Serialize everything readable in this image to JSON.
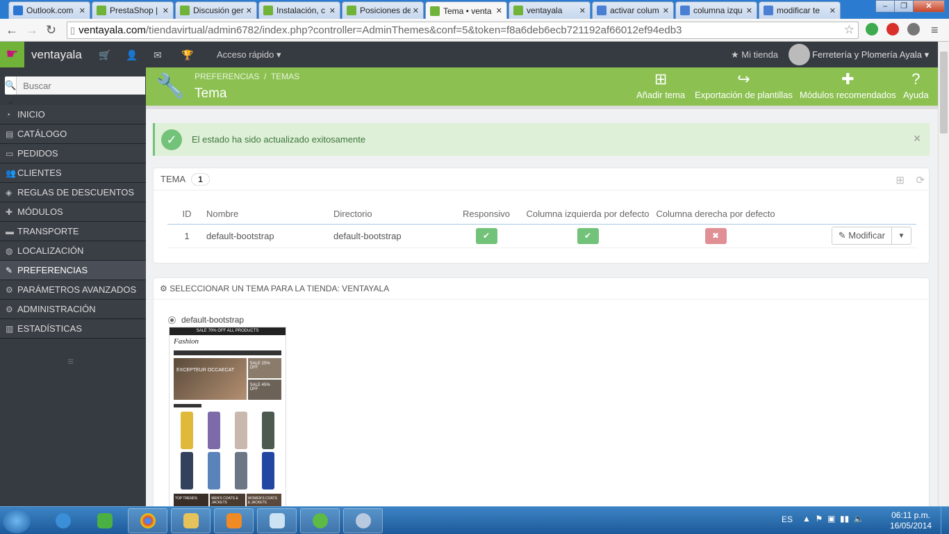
{
  "browser": {
    "tabs": [
      {
        "title": "Outlook.com",
        "color": "#2a76d2"
      },
      {
        "title": "PrestaShop | ",
        "color": "#71b239"
      },
      {
        "title": "Discusión gen",
        "color": "#71b239"
      },
      {
        "title": "Instalación, c",
        "color": "#71b239"
      },
      {
        "title": "Posiciones de",
        "color": "#71b239"
      },
      {
        "title": "Tema • venta",
        "color": "#71b239"
      },
      {
        "title": "ventayala",
        "color": "#71b239"
      },
      {
        "title": "activar colum",
        "color": "#4a7fd4"
      },
      {
        "title": "columna izqu",
        "color": "#4a7fd4"
      },
      {
        "title": "modificar te",
        "color": "#4a7fd4"
      }
    ],
    "url_domain": "ventayala.com",
    "url_rest": "/tiendavirtual/admin6782/index.php?controller=AdminThemes&conf=5&token=f8a6deb6ecb721192af66012ef94edb3"
  },
  "header": {
    "shop_name": "ventayala",
    "quick_access": "Acceso rápido",
    "my_store": "Mi tienda",
    "employee": "Ferretería y Plomería Ayala"
  },
  "sidebar": {
    "search_placeholder": "Buscar",
    "items": [
      {
        "label": "INICIO",
        "icon": "dashboard-icon"
      },
      {
        "label": "CATÁLOGO",
        "icon": "book-icon"
      },
      {
        "label": "PEDIDOS",
        "icon": "credit-card-icon"
      },
      {
        "label": "CLIENTES",
        "icon": "users-icon"
      },
      {
        "label": "REGLAS DE DESCUENTOS",
        "icon": "tag-icon"
      },
      {
        "label": "MÓDULOS",
        "icon": "puzzle-icon"
      },
      {
        "label": "TRANSPORTE",
        "icon": "truck-icon"
      },
      {
        "label": "LOCALIZACIÓN",
        "icon": "globe-icon"
      },
      {
        "label": "PREFERENCIAS",
        "icon": "wrench-icon"
      },
      {
        "label": "PARÁMETROS AVANZADOS",
        "icon": "cogs-icon"
      },
      {
        "label": "ADMINISTRACIÓN",
        "icon": "gear-icon"
      },
      {
        "label": "ESTADÍSTICAS",
        "icon": "bar-chart-icon"
      }
    ]
  },
  "page": {
    "breadcrumb_1": "PREFERENCIAS",
    "breadcrumb_sep": "/",
    "breadcrumb_2": "TEMAS",
    "title": "Tema",
    "toolbar": {
      "add_theme": "Añadir tema",
      "export": "Exportación de plantillas",
      "modules": "Módulos recomendados",
      "help": "Ayuda"
    }
  },
  "alert": {
    "message": "El estado ha sido actualizado exitosamente"
  },
  "theme_panel": {
    "title": "TEMA",
    "count": "1",
    "columns": [
      "ID",
      "Nombre",
      "Directorio",
      "Responsivo",
      "Columna izquierda por defecto",
      "Columna derecha por defecto"
    ],
    "rows": [
      {
        "id": "1",
        "name": "default-bootstrap",
        "directory": "default-bootstrap",
        "responsive": true,
        "left_column": true,
        "right_column": false
      }
    ],
    "edit_label": "Modificar"
  },
  "select_panel": {
    "title": "SELECCIONAR UN TEMA PARA LA TIENDA: VENTAYALA",
    "theme_name": "default-bootstrap",
    "preview": {
      "banner": "SALE 70% OFF ALL PRODUCTS",
      "logo": "Fashion",
      "hero_1": "EXCEPTEUR OCCAECAT",
      "hero_2": "SALE 25% OFF",
      "hero_3": "SALE 45% OFF",
      "tile_1": "TOP TRENDS",
      "tile_2": "MEN'S COATS & JACKETS",
      "tile_3": "WOMEN'S COATS & JACKETS"
    }
  },
  "taskbar": {
    "lang": "ES",
    "time": "06:11 p.m.",
    "date": "16/05/2014"
  }
}
